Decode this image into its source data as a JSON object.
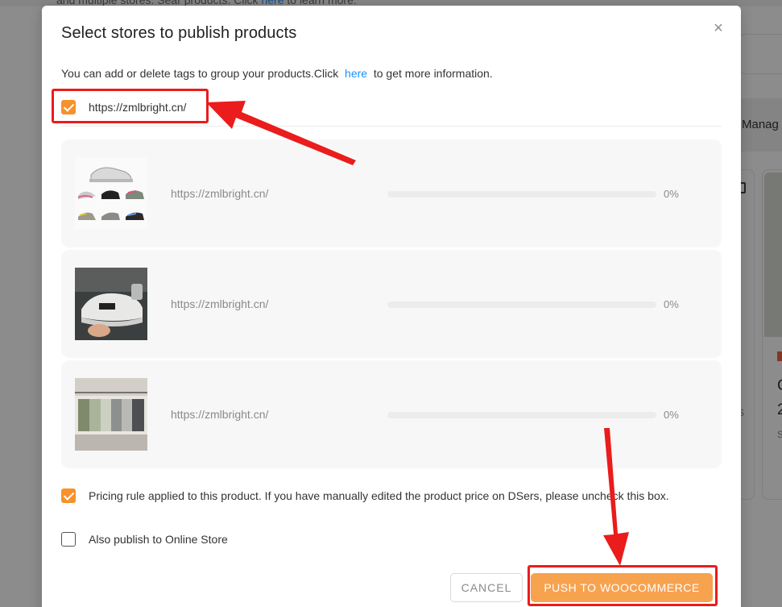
{
  "background": {
    "top_text_prefix": "and multiple stores. Sear products. Click ",
    "top_text_link": "here",
    "top_text_suffix": " to learn more.",
    "manage_label": "Manag",
    "char1": "C",
    "char2": "2",
    "char3": "S",
    "char4": "S"
  },
  "modal": {
    "title": "Select stores to publish products",
    "close_icon": "×",
    "intro_prefix": "You can add or delete tags to group your products.Click",
    "intro_link": "here",
    "intro_suffix": "to get more information.",
    "store": {
      "label": "https://zmlbright.cn/",
      "checked": true
    },
    "products": [
      {
        "store_url": "https://zmlbright.cn/",
        "progress_text": "0%",
        "progress": 0,
        "thumb": "sneakers-collage"
      },
      {
        "store_url": "https://zmlbright.cn/",
        "progress_text": "0%",
        "progress": 0,
        "thumb": "white-sneaker-in-hand"
      },
      {
        "store_url": "https://zmlbright.cn/",
        "progress_text": "0%",
        "progress": 0,
        "thumb": "shorts-on-hangers"
      }
    ],
    "pricing_rule": {
      "label": "Pricing rule applied to this product. If you have manually edited the product price on DSers, please uncheck this box.",
      "checked": true
    },
    "online_store": {
      "label": "Also publish to Online Store",
      "checked": false
    },
    "cancel_label": "CANCEL",
    "push_label": "PUSH TO WOOCOMMERCE"
  },
  "colors": {
    "accent": "#f7912b",
    "link": "#1a90ff",
    "annotation": "#ea1c1c"
  }
}
